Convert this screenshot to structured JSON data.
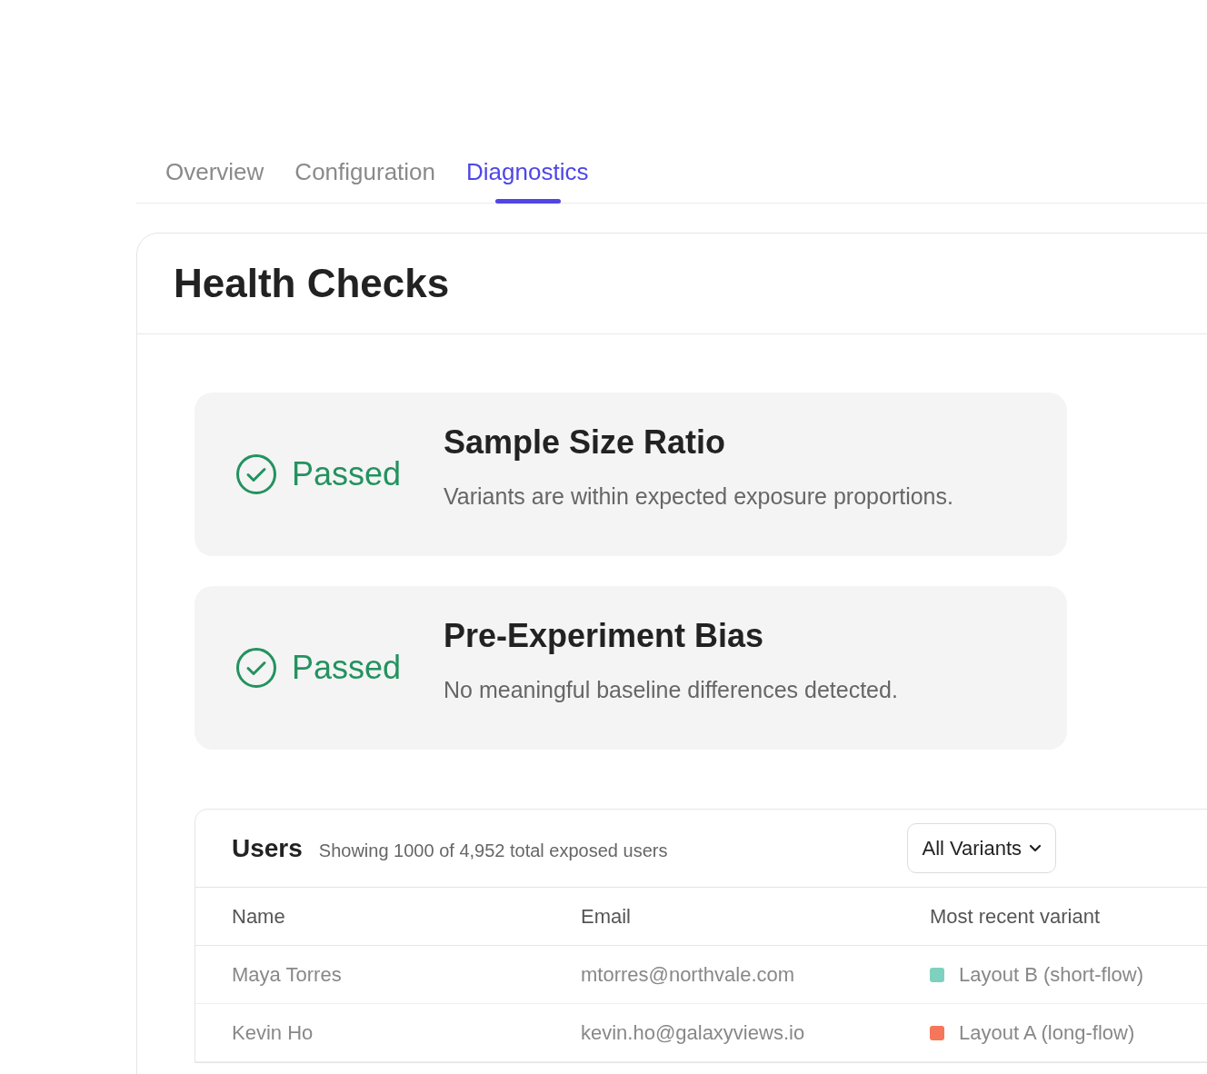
{
  "tabs": [
    {
      "label": "Overview",
      "selected": false
    },
    {
      "label": "Configuration",
      "selected": false
    },
    {
      "label": "Diagnostics",
      "selected": true
    }
  ],
  "panel": {
    "title": "Health Checks"
  },
  "checks": [
    {
      "status": "Passed",
      "kind": "passed",
      "title": "Sample Size Ratio",
      "description": "Variants are within expected exposure proportions."
    },
    {
      "status": "Passed",
      "kind": "passed",
      "title": "Pre-Experiment Bias",
      "description": "No meaningful baseline differences detected."
    }
  ],
  "users": {
    "title": "Users",
    "subtitle": "Showing 1000 of 4,952 total exposed users",
    "filter": "All Variants",
    "columns": [
      "Name",
      "Email",
      "Most recent variant"
    ],
    "rows": [
      {
        "name": "Maya Torres",
        "email": "mtorres@northvale.com",
        "variant": "Layout B (short-flow)",
        "color": "#7fd1bf"
      },
      {
        "name": "Kevin Ho",
        "email": "kevin.ho@galaxyviews.io",
        "variant": "Layout A (long-flow)",
        "color": "#f5765a"
      }
    ]
  }
}
